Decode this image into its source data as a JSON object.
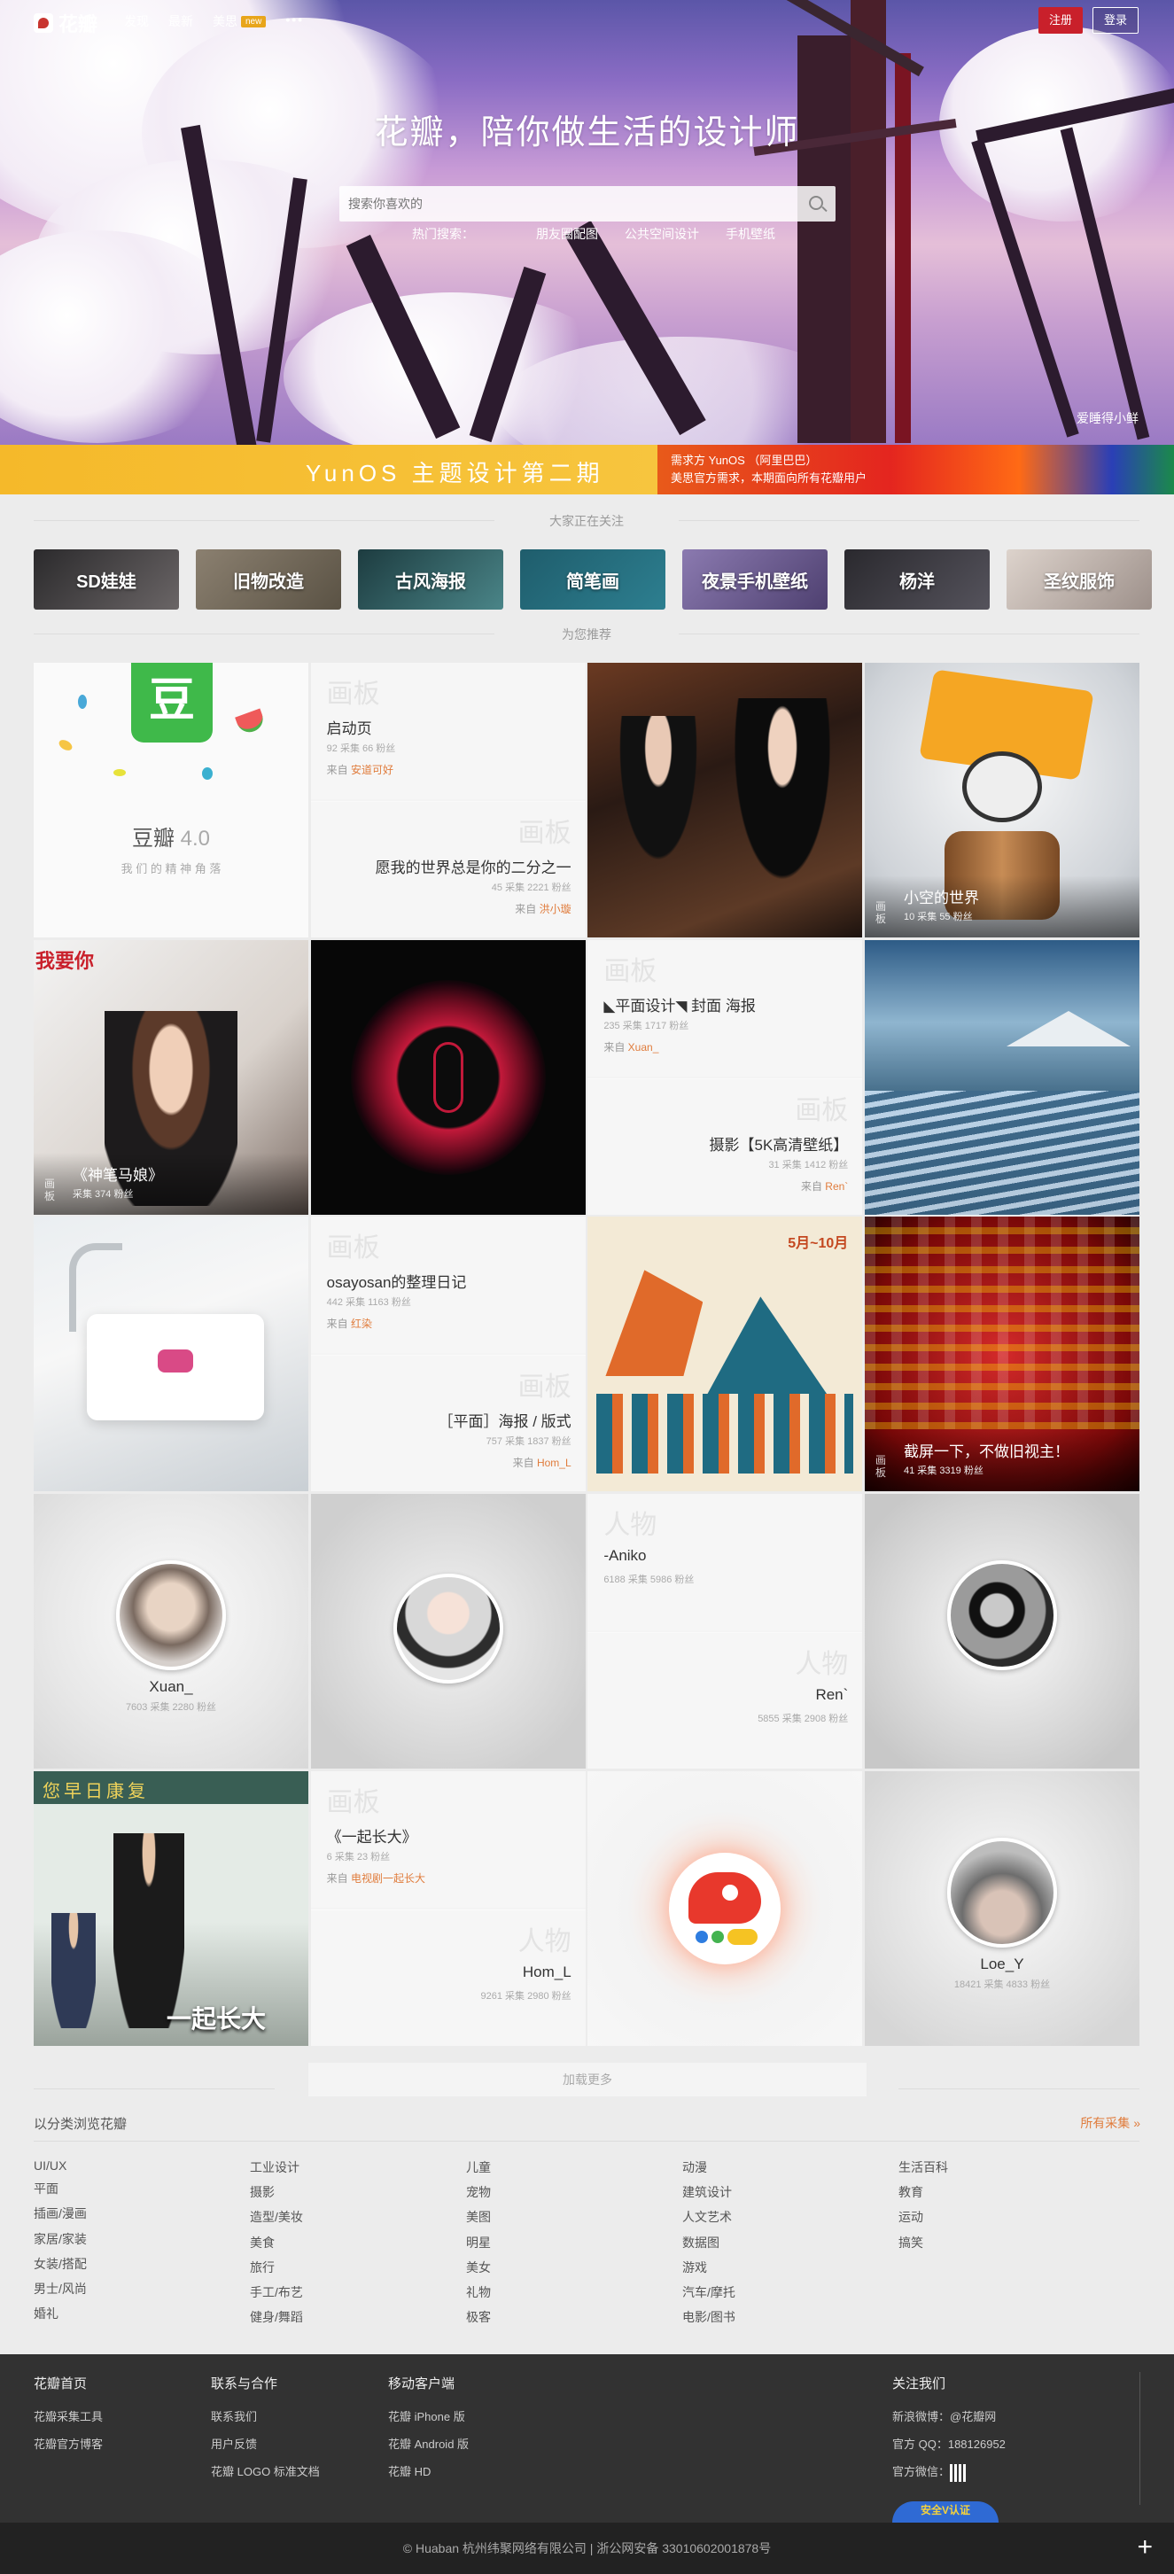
{
  "topbar": {
    "logo_text": "花瓣",
    "nav": [
      {
        "label": "发现"
      },
      {
        "label": "最新"
      },
      {
        "label": "美思",
        "badge": "new"
      },
      {
        "label": "•••"
      }
    ],
    "register_label": "注册",
    "login_label": "登录"
  },
  "hero": {
    "slogan": "花瓣，陪你做生活的设计师",
    "search_placeholder": "搜索你喜欢的",
    "hot_links": [
      "热门搜索：",
      "朋友圈配图",
      "公共空间设计",
      "手机壁纸"
    ],
    "credit": "爱睡得小鲜"
  },
  "banner": {
    "title": "YunOS 主题设计第二期",
    "sub_line1": "需求方 YunOS （阿里巴巴）",
    "sub_line2": "美思官方需求，本期面向所有花瓣用户"
  },
  "following": {
    "heading": "大家正在关注",
    "tags": [
      "SD娃娃",
      "旧物改造",
      "古风海报",
      "简笔画",
      "夜景手机壁纸",
      "杨洋",
      "圣纹服饰"
    ],
    "tag_colors": [
      "#3c3a3c",
      "#7b7265",
      "#2f5b5e",
      "#246c7a",
      "#6c5e8c",
      "#3b3a40",
      "#b9ada8"
    ]
  },
  "recommend": {
    "heading": "为您推荐",
    "kind_board": "画板",
    "kind_person": "人物",
    "from_label": "来自",
    "douban": {
      "name": "豆瓣",
      "version": "4.0",
      "tagline": "我 们 的 精 神 角 落"
    },
    "boards": [
      {
        "title": "启动页",
        "stats": "92 采集   66 粉丝",
        "from": "安道可好"
      },
      {
        "title": "愿我的世界总是你的二分之一",
        "stats": "45 采集   2221 粉丝",
        "from": "洪小璇"
      },
      {
        "title": "◣平面设计◥ 封面 海报",
        "stats": "235 采集   1717 粉丝",
        "from": "Xuan_"
      },
      {
        "title": "摄影【5K高清壁纸】",
        "stats": "31 采集   1412 粉丝",
        "from": "Ren`"
      },
      {
        "title": "osayosan的整理日记",
        "stats": "442 采集   1163 粉丝",
        "from": "红染"
      },
      {
        "title": "［平面］海报 / 版式",
        "stats": "757 采集   1837 粉丝",
        "from": "Hom_L"
      },
      {
        "title": "《一起长大》",
        "stats": "6 采集   23 粉丝",
        "from": "电视剧一起长大"
      }
    ],
    "overlays": [
      {
        "tag": "画板",
        "title": "小空的世界",
        "stats": "10 采集   55 粉丝"
      },
      {
        "tag": "画板",
        "title": "《神笔马娘》",
        "stats": "采集   374 粉丝"
      },
      {
        "tag": "画板",
        "title": "截屏一下，不做旧视主！",
        "stats": "41 采集   3319 粉丝"
      }
    ],
    "people": [
      {
        "name": "Xuan_",
        "stats": "7603 采集   2280 粉丝"
      },
      {
        "name": "-Aniko",
        "stats": "6188 采集   5986 粉丝"
      },
      {
        "name": "Ren`",
        "stats": "5855 采集   2908 粉丝"
      },
      {
        "name": "Hom_L",
        "stats": "9261 采集   2980 粉丝"
      },
      {
        "name": "Loe_Y",
        "stats": "18421 采集   4833 粉丝"
      }
    ],
    "poster_text": "5月~10月",
    "ad_text": "一起长大",
    "banner_text": "我要你"
  },
  "load_more": "加载更多",
  "categories": {
    "title": "以分类浏览花瓣",
    "all_label": "所有采集 »",
    "columns": [
      [
        "UI/UX",
        "平面",
        "插画/漫画",
        "家居/家装",
        "女装/搭配",
        "男士/风尚",
        "婚礼"
      ],
      [
        "工业设计",
        "摄影",
        "造型/美妆",
        "美食",
        "旅行",
        "手工/布艺",
        "健身/舞蹈"
      ],
      [
        "儿童",
        "宠物",
        "美图",
        "明星",
        "美女",
        "礼物",
        "极客"
      ],
      [
        "动漫",
        "建筑设计",
        "人文艺术",
        "数据图",
        "游戏",
        "汽车/摩托",
        "电影/图书"
      ],
      [
        "生活百科",
        "教育",
        "运动",
        "搞笑"
      ]
    ]
  },
  "footer": {
    "col1": {
      "title": "花瓣首页",
      "links": [
        "花瓣采集工具",
        "花瓣官方博客"
      ]
    },
    "col2": {
      "title": "联系与合作",
      "links": [
        "联系我们",
        "用户反馈",
        "花瓣 LOGO 标准文档"
      ]
    },
    "col3": {
      "title": "移动客户端",
      "links": [
        "花瓣 iPhone 版",
        "花瓣 Android 版",
        "花瓣 HD"
      ]
    },
    "col4": {
      "title": "关注我们",
      "links": [
        "新浪微博：@花瓣网",
        "官方 QQ：188126952",
        "官方微信："
      ]
    },
    "badge": "安全V认证",
    "copyright": "© Huaban 杭州纬聚网络有限公司  |  浙公网安备 33010602001878号"
  }
}
